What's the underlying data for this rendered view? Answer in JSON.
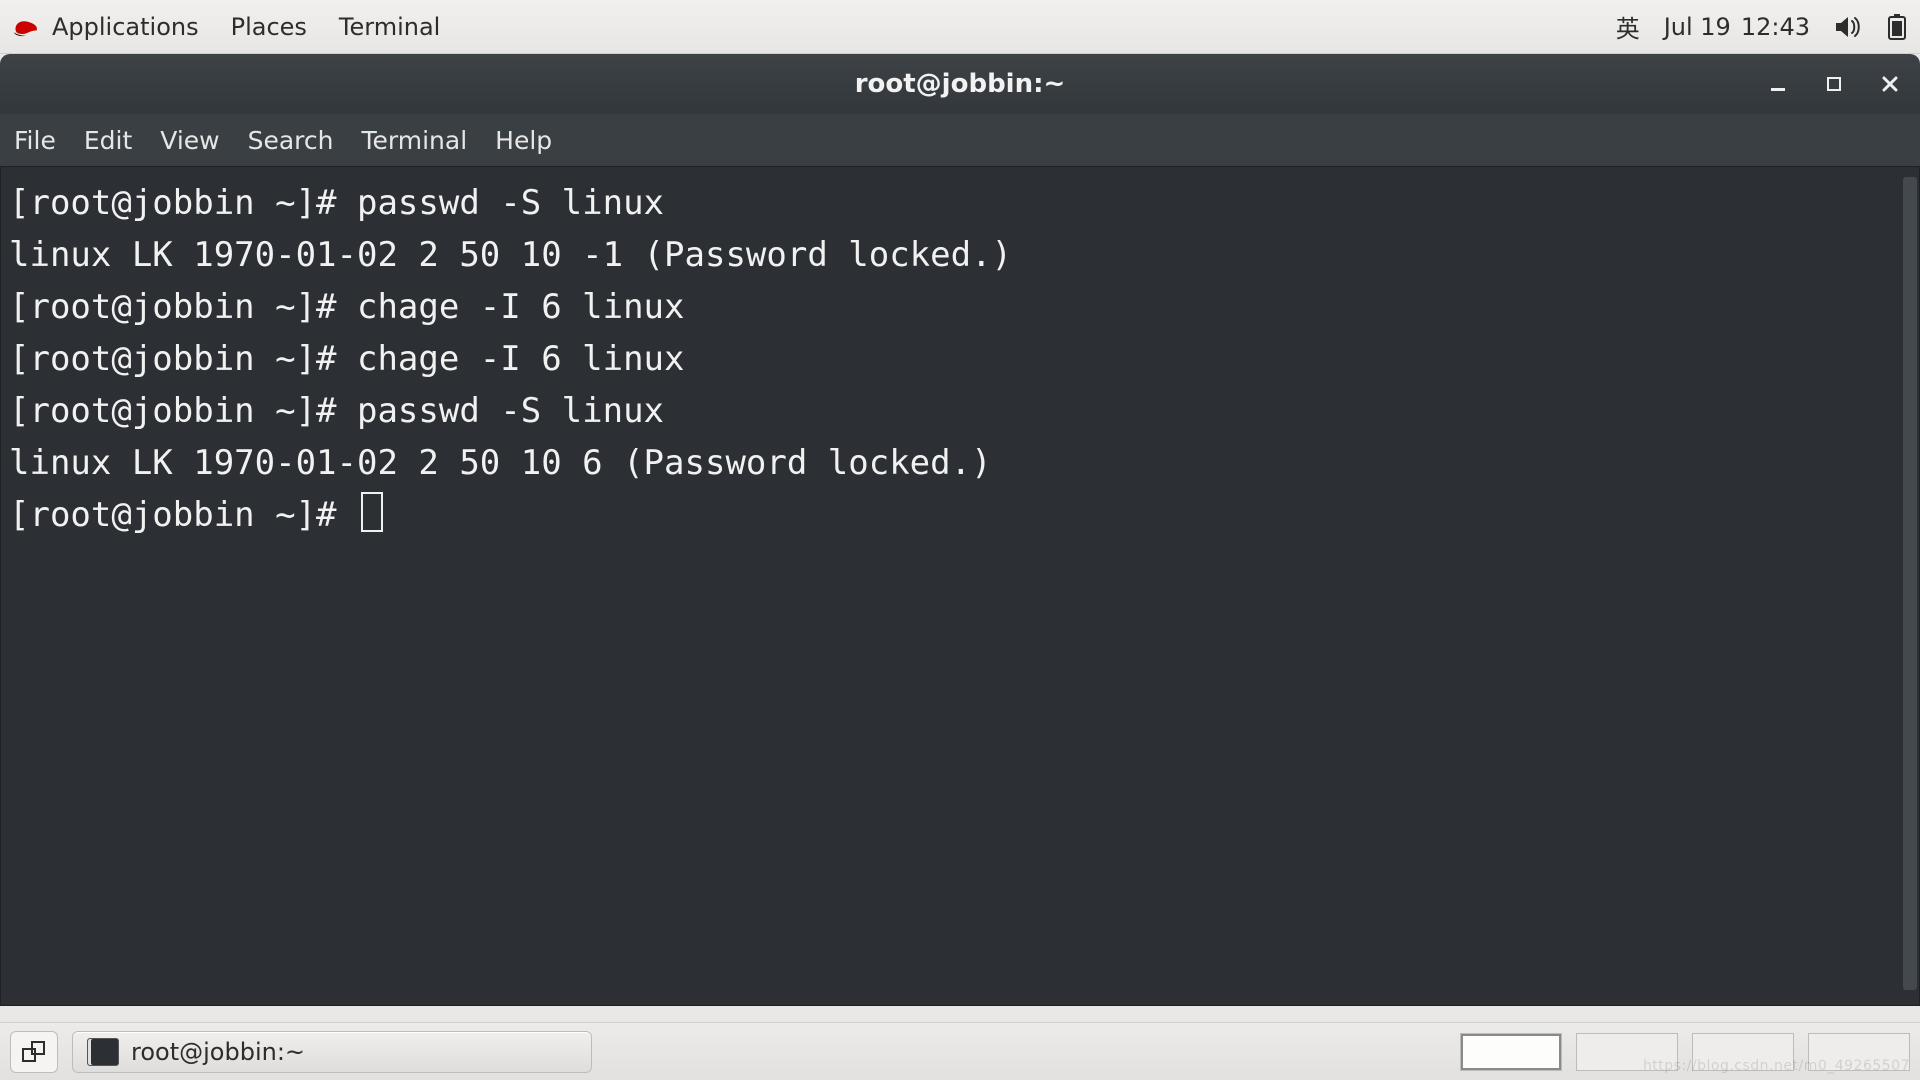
{
  "top_panel": {
    "applications": "Applications",
    "places": "Places",
    "terminal": "Terminal",
    "input_method": "英",
    "date": "Jul 19",
    "time": "12:43"
  },
  "window": {
    "title": "root@jobbin:~"
  },
  "menubar": {
    "file": "File",
    "edit": "Edit",
    "view": "View",
    "search": "Search",
    "terminal": "Terminal",
    "help": "Help"
  },
  "terminal": {
    "lines": [
      "[root@jobbin ~]# passwd -S linux",
      "linux LK 1970-01-02 2 50 10 -1 (Password locked.)",
      "[root@jobbin ~]# chage -I 6 linux",
      "[root@jobbin ~]# chage -I 6 linux",
      "[root@jobbin ~]# passwd -S linux",
      "linux LK 1970-01-02 2 50 10 6 (Password locked.)"
    ],
    "prompt": "[root@jobbin ~]# "
  },
  "taskbar": {
    "task_title": "root@jobbin:~"
  },
  "watermark": "https://blog.csdn.net/m0_49265507"
}
